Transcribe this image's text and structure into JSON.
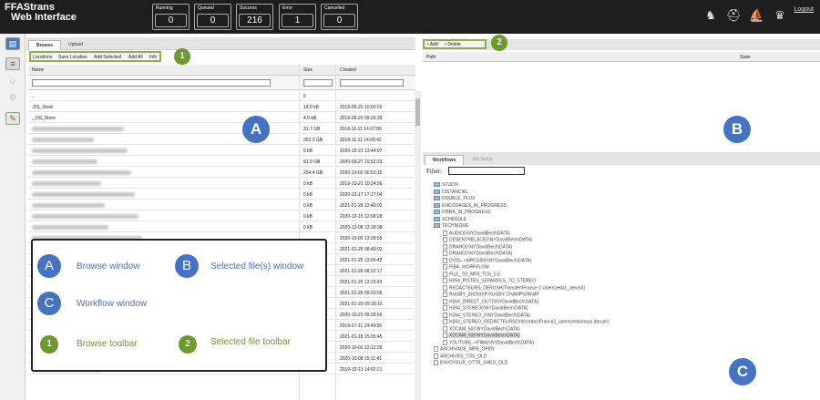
{
  "header": {
    "app_name_line1": "FFAStrans",
    "app_name_line2": "Web Interface",
    "stats": [
      {
        "label": "Running",
        "value": "0"
      },
      {
        "label": "Queued",
        "value": "0"
      },
      {
        "label": "Success",
        "value": "216"
      },
      {
        "label": "Error",
        "value": "1"
      },
      {
        "label": "Cancelled",
        "value": "0"
      }
    ],
    "logout": "Logout"
  },
  "browse": {
    "tabs": [
      "Browse",
      "Upload"
    ],
    "toolbar": [
      "Locations",
      "Save Location",
      "Add Selected",
      "Add All",
      "Info"
    ],
    "columns": {
      "name": "Name",
      "size": "Size",
      "created": "Created"
    },
    "rows": [
      {
        "name": "..",
        "size": "0",
        "created": ""
      },
      {
        "name": ".DS_Store",
        "size": "14.0 kB",
        "created": "2019-05-20 10:00:26"
      },
      {
        "name": "._DS_Store",
        "size": "4.0 kB",
        "created": "2019-05-20 09:26:39"
      },
      {
        "name": "",
        "size": "31.7 GB",
        "created": "2018-11-11 14:07:00"
      },
      {
        "name": "",
        "size": "262.3 GB",
        "created": "2018-11-11 14:05:42"
      },
      {
        "name": "",
        "size": "0 kB",
        "created": "2020-12-23 13:44:07"
      },
      {
        "name": "",
        "size": "61.9 GB",
        "created": "2020-09-27 10:52:23"
      },
      {
        "name": "",
        "size": "204.4 GB",
        "created": "2020-10-02 00:53:15"
      },
      {
        "name": "",
        "size": "0 kB",
        "created": "2019-10-21 10:24:36"
      },
      {
        "name": "",
        "size": "0 kB",
        "created": "2020-12-17 17:17:04"
      },
      {
        "name": "",
        "size": "0 kB",
        "created": "2021-01-29 13:49:02"
      },
      {
        "name": "",
        "size": "0 kB",
        "created": "2020-12-15 12:08:28"
      },
      {
        "name": "",
        "size": "0 kB",
        "created": "2020-12-08 13:18:38"
      },
      {
        "name": "",
        "size": "",
        "created": "2020-10-05 13:39:55"
      },
      {
        "name": "",
        "size": "",
        "created": "2021-01-25 08:49:02"
      },
      {
        "name": "",
        "size": "",
        "created": "2021-01-25 13:06:42"
      },
      {
        "name": "",
        "size": "",
        "created": "2021-01-29 08:22:17"
      },
      {
        "name": "",
        "size": "",
        "created": "2021-01-25 13:15:43"
      },
      {
        "name": "",
        "size": "",
        "created": "2021-01-29 09:20:06"
      },
      {
        "name": "",
        "size": "",
        "created": "2021-01-29 09:18:10"
      },
      {
        "name": "",
        "size": "",
        "created": "2020-10-21 09:28:56"
      },
      {
        "name": "",
        "size": "",
        "created": "2019-07-11 14:49:55"
      },
      {
        "name": "",
        "size": "",
        "created": "2021-01-18 15:35:45"
      },
      {
        "name": "",
        "size": "",
        "created": "2020-10-02 12:12:28"
      },
      {
        "name": "",
        "size": "0 kB",
        "created": "2020-10-08 15:11:41"
      },
      {
        "name": "",
        "size": "0 kB",
        "created": "2019-12-13 14:02:21"
      }
    ]
  },
  "selected": {
    "add": "Add",
    "delete": "Delete",
    "columns": {
      "path": "Path",
      "state": "State"
    }
  },
  "workflows": {
    "tabs": [
      "Workflows",
      "Job Setup"
    ],
    "filter_label": "Filter:",
    "folders": [
      "STUDIX",
      "DISTANCIEL",
      "DOUBLE_PLUX",
      "ENCODAGES_IN_PROGRESS",
      "FIBRA_IN_PROGRESS",
      "SCHEDULE",
      "TECHNIQUE"
    ],
    "technique_items": [
      "AUDIO(\\\\NYDavidBech\\DATA)",
      "DESENTRELACE(\\\\NYDavidBech\\DATA)",
      "DRAHO(\\\\NYDavidBech\\DATA)",
      "DRAHO(\\\\NYDavidBech\\DATA)",
      "DV25-->MPEG50(\\\\NYDavidBech\\DATA)",
      "FIBA_WORKFLOW",
      "FILE_TO_MP4_TDS_2.0",
      "H264_PISTES_SEPAREES_TO_STEREO",
      "REDACTEURS_DERUSH(Transfert\\France 2 Users\\redac_derush)",
      "RUGBY_2H250XP RUGBY CHAMPIONNAT",
      "H264_DIRECT_OUT(\\\\NYDavidBech\\DATA)",
      "H264_STEREO(\\\\NYDavidBech\\DATA)",
      "H264_STEREO_(\\\\NYDavidBech\\DATA)",
      "H264_STEREO_REDACTEURS(\\\\nfs\\redac\\France2_users\\redacteurs derush)",
      "XDCAM_50(\\\\NYDavidBech\\DATA)",
      "XDCAM_50(\\\\NYDavidBech\\DATA)",
      "YOUTUBE-->FIBA(\\\\NYDavidBech\\DATA)"
    ],
    "root_items": [
      "ARCHIVAGE_MPB_OPEN",
      "ARCHIVES_TDS_OLD",
      "ENVOYEUR_OTTR_SHED_OLD"
    ]
  },
  "annotations": {
    "a": "A",
    "b": "B",
    "c": "C",
    "one": "1",
    "two": "2",
    "legend": {
      "browse_window": "Browse window",
      "selected_window": "Selected file(s) window",
      "workflow_window": "Workflow window",
      "browse_toolbar": "Browse toolbar",
      "selected_toolbar": "Selected file toolbar"
    }
  },
  "colors": {
    "annotation_blue": "#4472c4",
    "annotation_green": "#6d9a2c",
    "header_bg": "#1e1e1e"
  }
}
